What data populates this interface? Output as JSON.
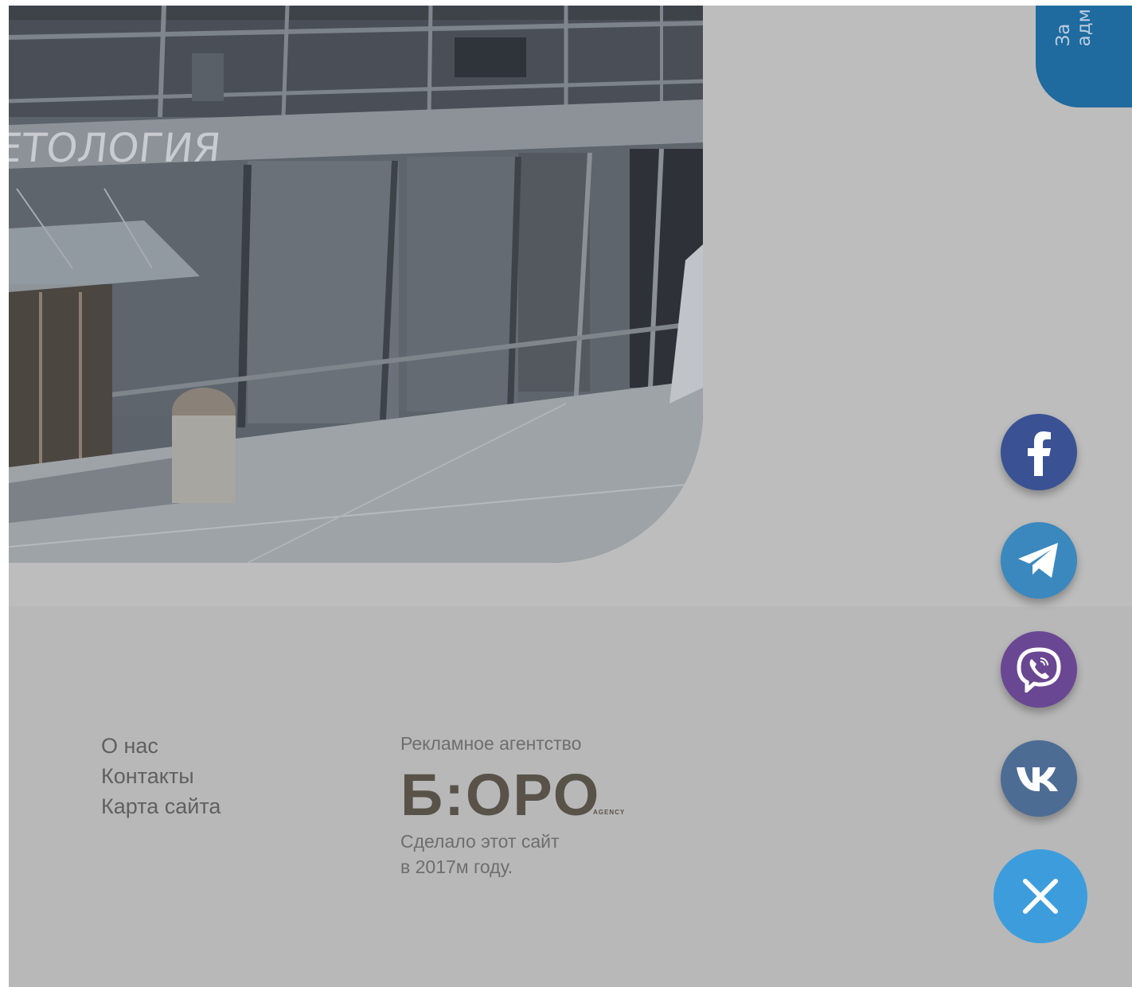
{
  "photo": {
    "sign_text": "ЕТОЛОГИЯ"
  },
  "side_tab": {
    "text_line_1": "За",
    "text_line_2": "адм"
  },
  "footer": {
    "links": [
      {
        "label": "О нас"
      },
      {
        "label": "Контакты"
      },
      {
        "label": "Карта сайта"
      }
    ],
    "agency": {
      "caption": "Рекламное агентство",
      "logo_text": "Б:ОРО",
      "logo_subtext": "AGENCY",
      "credit_line_1": "Сделало этот сайт",
      "credit_line_2": "в 2017м году."
    }
  },
  "social": [
    {
      "name": "facebook",
      "icon": "facebook-icon",
      "color": "#3a5293"
    },
    {
      "name": "telegram",
      "icon": "telegram-icon",
      "color": "#3a88be"
    },
    {
      "name": "viber",
      "icon": "viber-icon",
      "color": "#6a4792"
    },
    {
      "name": "vk",
      "icon": "vk-icon",
      "color": "#4c6c93"
    },
    {
      "name": "close",
      "icon": "close-icon",
      "color": "#3d9ddc"
    }
  ],
  "colors": {
    "overlay_gray": "#bdbdbd",
    "footer_gray": "#b8b8b8",
    "tab_blue": "#1f6a9e",
    "text_gray": "#606060",
    "logo_brown": "#585248"
  }
}
